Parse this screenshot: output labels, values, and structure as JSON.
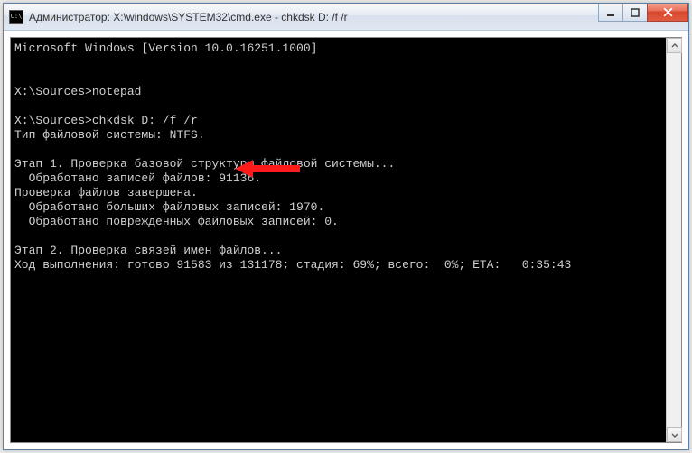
{
  "window": {
    "app_icon_label": "C:\\",
    "title": "Администратор: X:\\windows\\SYSTEM32\\cmd.exe - chkdsk  D: /f /r"
  },
  "controls": {
    "minimize_tip": "Свернуть",
    "maximize_tip": "Развернуть",
    "close_tip": "Закрыть"
  },
  "scrollbar": {
    "up_tip": "Прокрутить вверх",
    "down_tip": "Прокрутить вниз"
  },
  "console": {
    "line1": "Microsoft Windows [Version 10.0.16251.1000]",
    "blank1": "",
    "blank2": "",
    "prompt1": "X:\\Sources>notepad",
    "blank3": "",
    "prompt2": "X:\\Sources>chkdsk D: /f /r",
    "fs_type": "Тип файловой системы: NTFS.",
    "blank4": "",
    "stage1": "Этап 1. Проверка базовой структуры файловой системы...",
    "records": "  Обработано записей файлов: 91136.",
    "done1": "Проверка файлов завершена.",
    "large": "  Обработано больших файловых записей: 1970.",
    "bad": "  Обработано поврежденных файловых записей: 0.",
    "blank5": "",
    "stage2": "Этап 2. Проверка связей имен файлов...",
    "progress": "Ход выполнения: готово 91583 из 131178; стадия: 69%; всего:  0%; ETA:   0:35:43"
  },
  "annotation": {
    "arrow_name": "red-arrow-annotation"
  }
}
